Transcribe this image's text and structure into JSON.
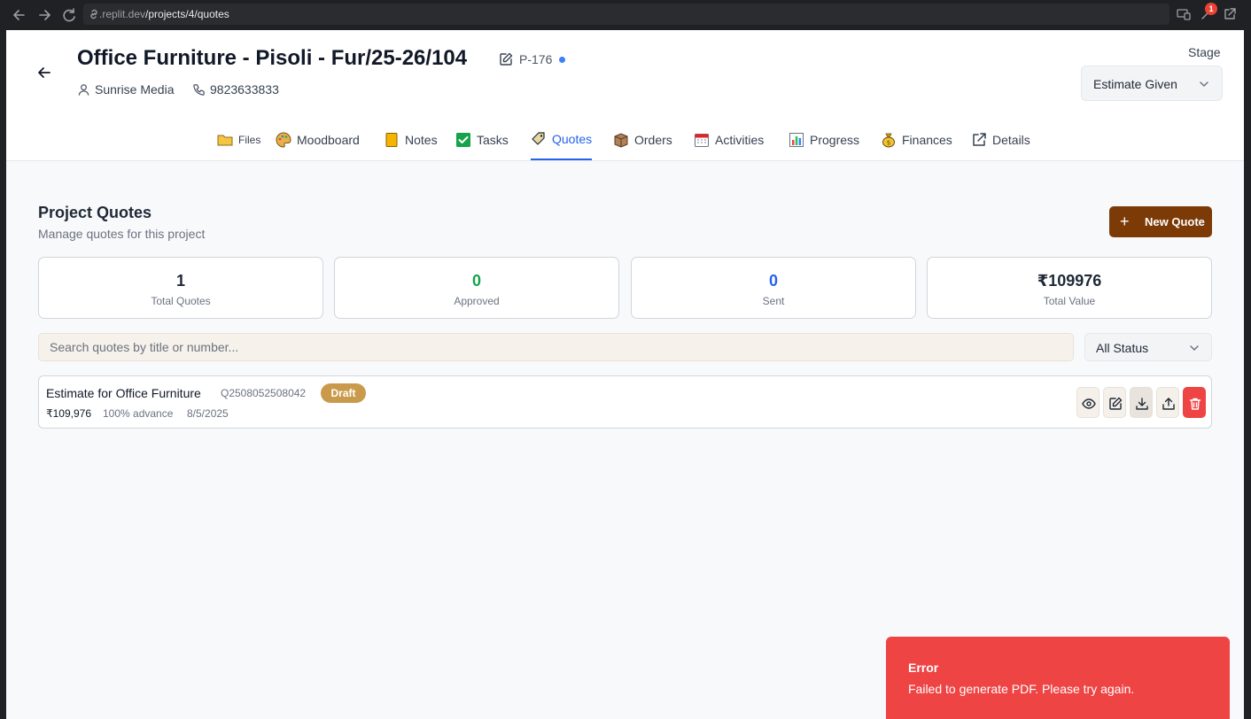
{
  "browser": {
    "url_host": ".replit.dev",
    "url_path": "/projects/4/quotes",
    "notification_count": "1"
  },
  "project": {
    "title": "Office Furniture - Pisoli - Fur/25-26/104",
    "code": "P-176",
    "client": "Sunrise Media",
    "phone": "9823633833",
    "stage_label": "Stage",
    "stage_value": "Estimate Given"
  },
  "tabs": [
    {
      "label": "Files",
      "icon": "folder-icon"
    },
    {
      "label": "Moodboard",
      "icon": "palette-icon"
    },
    {
      "label": "Notes",
      "icon": "notepad-icon"
    },
    {
      "label": "Tasks",
      "icon": "checkbox-icon"
    },
    {
      "label": "Quotes",
      "icon": "tag-icon"
    },
    {
      "label": "Orders",
      "icon": "package-icon"
    },
    {
      "label": "Activities",
      "icon": "calendar-icon"
    },
    {
      "label": "Progress",
      "icon": "bar-chart-icon"
    },
    {
      "label": "Finances",
      "icon": "money-bag-icon"
    },
    {
      "label": "Details",
      "icon": "external-link-icon"
    }
  ],
  "quotes_section": {
    "title": "Project Quotes",
    "subtitle": "Manage quotes for this project",
    "new_quote_label": "New Quote"
  },
  "stats": [
    {
      "value": "1",
      "label": "Total Quotes",
      "color": "#1f2937"
    },
    {
      "value": "0",
      "label": "Approved",
      "color": "#16a34a"
    },
    {
      "value": "0",
      "label": "Sent",
      "color": "#2563eb"
    },
    {
      "value": "₹109976",
      "label": "Total Value",
      "color": "#1f2937"
    }
  ],
  "search": {
    "placeholder": "Search quotes by title or number..."
  },
  "status_filter": {
    "value": "All Status"
  },
  "quote": {
    "title": "Estimate for Office Furniture",
    "number": "Q2508052508042",
    "status": "Draft",
    "amount": "₹109,976",
    "advance": "100% advance",
    "date": "8/5/2025"
  },
  "toast": {
    "title": "Error",
    "message": "Failed to generate PDF. Please try again."
  },
  "colors": {
    "accent": "#2563eb",
    "brand_button": "#7c3a06",
    "draft_badge": "#c99a4b",
    "error": "#ef4444"
  }
}
